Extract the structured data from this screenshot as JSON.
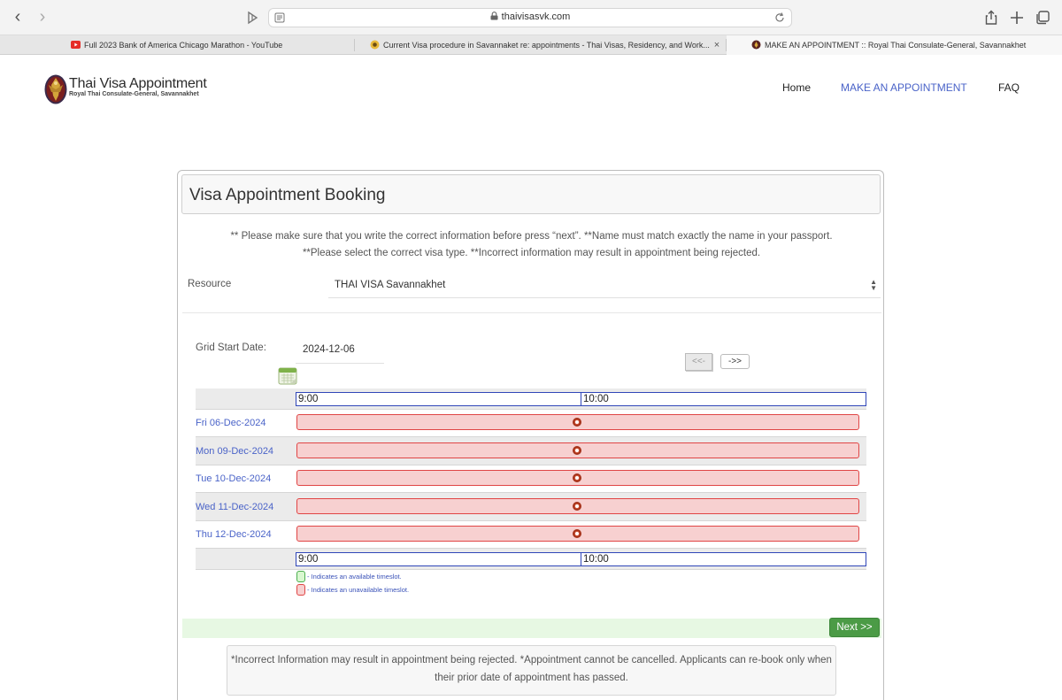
{
  "browser": {
    "url": "thaivisasvk.com",
    "tabs": [
      {
        "title": "Full 2023 Bank of America Chicago Marathon - YouTube",
        "active": false
      },
      {
        "title": "Current Visa procedure in Savannaket re: appointments - Thai Visas, Residency, and Work...",
        "active": false
      },
      {
        "title": "MAKE AN APPOINTMENT :: Royal Thai Consulate-General, Savannakhet",
        "active": true
      }
    ],
    "close_glyph": "×"
  },
  "site": {
    "logo_title": "Thai Visa Appointment",
    "logo_subtitle": "Royal Thai Consulate-General, Savannakhet",
    "menu": [
      {
        "label": "Home",
        "active": false
      },
      {
        "label": "MAKE AN APPOINTMENT",
        "active": true
      },
      {
        "label": "FAQ",
        "active": false
      }
    ]
  },
  "booking": {
    "title": "Visa Appointment Booking",
    "notice_line1": "** Please make sure that you write the correct information before press “next”. **Name must match exactly the name in your passport.",
    "notice_line2": "**Please select the correct visa type. **Incorrect information may result in appointment being rejected.",
    "resource_label": "Resource",
    "resource_value": "THAI VISA Savannakhet",
    "grid_start_label": "Grid Start Date:",
    "grid_start_value": "2024-12-06",
    "prev_label": "<<-",
    "next_label": "->>",
    "times": [
      "9:00",
      "10:00"
    ],
    "dates": [
      "Fri 06-Dec-2024",
      "Mon 09-Dec-2024",
      "Tue 10-Dec-2024",
      "Wed 11-Dec-2024",
      "Thu 12-Dec-2024"
    ],
    "legend_available": "- Indicates an available timeslot.",
    "legend_unavailable": "- Indicates an unavailable timeslot.",
    "next_button": "Next >>",
    "footer_note": "*Incorrect Information may result in appointment being rejected. *Appointment cannot be cancelled. Applicants can re-book only when their prior date of appointment has passed."
  },
  "colors": {
    "link": "#4a63c8",
    "unavailable_fill": "#f7d0d0",
    "unavailable_border": "#e04545",
    "available_fill": "#d9f7d0",
    "available_border": "#4caf50",
    "next_button": "#4b9b46"
  }
}
